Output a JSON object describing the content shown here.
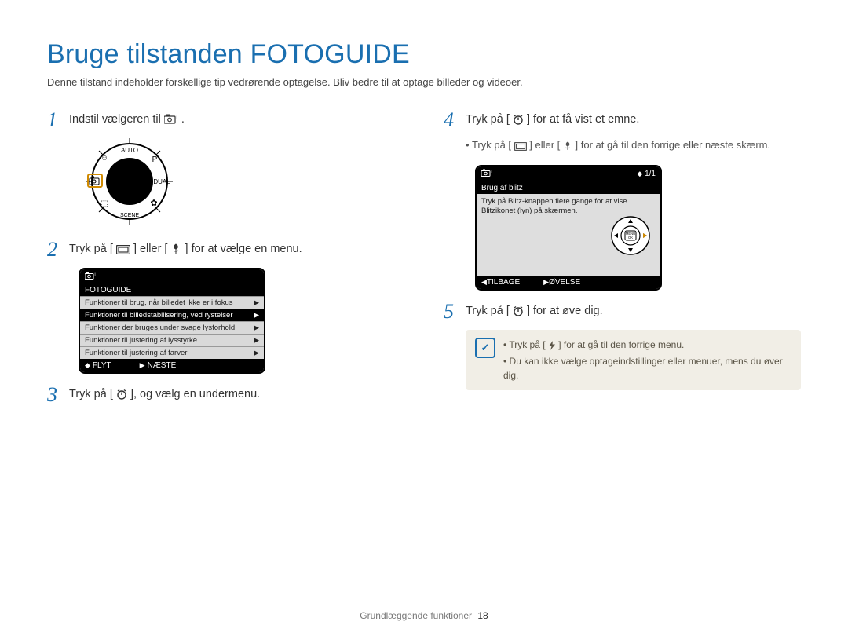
{
  "title": "Bruge tilstanden FOTOGUIDE",
  "subtitle": "Denne tilstand indeholder forskellige tip vedrørende optagelse. Bliv bedre til at optage billeder og videoer.",
  "steps": {
    "s1": {
      "num": "1",
      "pre": "Indstil vælgeren til ",
      "post": "."
    },
    "s2": {
      "num": "2",
      "pre": "Tryk på [",
      "mid": "] eller [",
      "post": "] for at vælge en menu."
    },
    "s3": {
      "num": "3",
      "pre": "Tryk på [",
      "post": "], og vælg en undermenu."
    },
    "s4": {
      "num": "4",
      "pre": "Tryk på [",
      "post": "] for at få vist et emne."
    },
    "s5": {
      "num": "5",
      "pre": "Tryk på [",
      "post": "] for at øve dig."
    }
  },
  "bullets4": {
    "line1a": "Tryk på [",
    "line1b": "] eller [",
    "line1c": "] for at gå til den forrige eller næste skærm."
  },
  "lcd1": {
    "title": "FOTOGUIDE",
    "rows": [
      "Funktioner til brug, når billedet ikke er i fokus",
      "Funktioner til billedstabilisering, ved rystelser",
      "Funktioner der bruges under svage lysforhold",
      "Funktioner til justering af lysstyrke",
      "Funktioner til justering af farver"
    ],
    "selected_index": 1,
    "foot_left": "FLYT",
    "foot_right": "NÆSTE"
  },
  "lcd2": {
    "page": "1/1",
    "title": "Brug af blitz",
    "body": "Tryk på Blitz-knappen flere gange for at vise Blitzikonet (lyn) på skærmen.",
    "foot_left": "TILBAGE",
    "foot_right": "ØVELSE",
    "knob_label": "MENU\nOK"
  },
  "info": {
    "l1a": "Tryk på [",
    "l1b": "] for at gå til den forrige menu.",
    "l2": "Du kan ikke vælge optageindstillinger eller menuer, mens du øver dig."
  },
  "footer": {
    "section": "Grundlæggende funktioner",
    "page": "18"
  }
}
